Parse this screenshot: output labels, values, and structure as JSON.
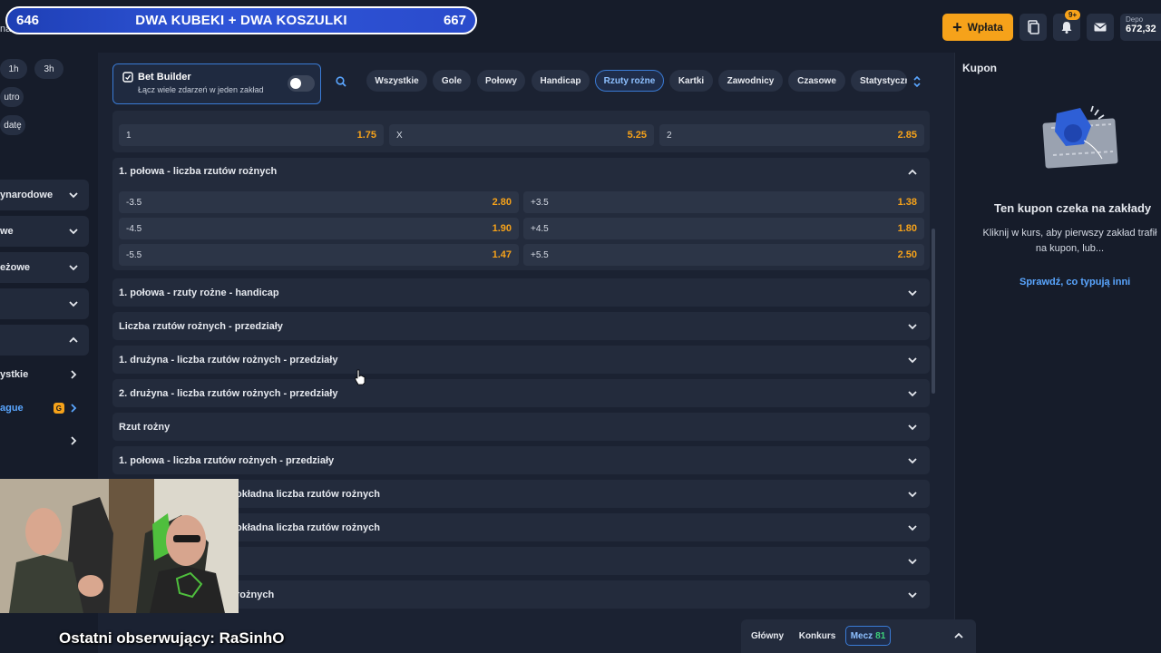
{
  "banner": {
    "left_count": "646",
    "title": "DWA KUBEKI + DWA KOSZULKI",
    "right_count": "667"
  },
  "header": {
    "left_fragment": "na",
    "deposit_label": "Wpłata",
    "notifications_badge": "9+",
    "balance_label": "Depo",
    "balance_value": "672,32"
  },
  "sidebar": {
    "time_filters": [
      "1h",
      "3h"
    ],
    "date_filters": [
      "utro",
      "datę"
    ],
    "items": [
      {
        "label": "ynarodowe"
      },
      {
        "label": "we"
      },
      {
        "label": "eżowe"
      },
      {
        "label": ""
      },
      {
        "label": ""
      }
    ],
    "sub_items": [
      {
        "label": "ystkie"
      },
      {
        "label": "ague",
        "badge": "G"
      },
      {
        "label": ""
      },
      {
        "label": ""
      }
    ],
    "bottom_fragment": "ague"
  },
  "bet_builder": {
    "title": "Bet Builder",
    "subtitle": "Łącz wiele zdarzeń w jeden zakład",
    "enabled": false
  },
  "filters": {
    "items": [
      "Wszystkie",
      "Gole",
      "Połowy",
      "Handicap",
      "Rzuty rożne",
      "Kartki",
      "Zawodnicy",
      "Czasowe",
      "Statystyczne"
    ],
    "active": "Rzuty rożne"
  },
  "top_odds": [
    {
      "label": "1",
      "value": "1.75"
    },
    {
      "label": "X",
      "value": "5.25"
    },
    {
      "label": "2",
      "value": "2.85"
    }
  ],
  "expanded_market": {
    "title": "1. połowa - liczba rzutów rożnych",
    "rows": [
      {
        "left_label": "-3.5",
        "left_value": "2.80",
        "right_label": "+3.5",
        "right_value": "1.38"
      },
      {
        "left_label": "-4.5",
        "left_value": "1.90",
        "right_label": "+4.5",
        "right_value": "1.80"
      },
      {
        "left_label": "-5.5",
        "left_value": "1.47",
        "right_label": "+5.5",
        "right_value": "2.50"
      }
    ]
  },
  "markets": [
    "1. połowa - rzuty rożne - handicap",
    "Liczba rzutów rożnych - przedziały",
    "1. drużyna - liczba rzutów rożnych - przedziały",
    "2. drużyna - liczba rzutów rożnych - przedziały",
    "Rzut rożny",
    "1. połowa - liczba rzutów rożnych - przedziały",
    "okładna liczba rzutów rożnych",
    "okładna liczba rzutów rożnych",
    "",
    "rożnych"
  ],
  "betslip": {
    "title": "Kupon",
    "empty_title": "Ten kupon czeka na zakłady",
    "empty_desc": "Kliknij w kurs, aby pierwszy zakład trafił na kupon, lub...",
    "link": "Sprawdź, co typują inni"
  },
  "bottom_tabs": {
    "tab1": "Główny",
    "tab2": "Konkurs",
    "tab3": "Mecz",
    "tab3_count": "81"
  },
  "overlay": {
    "follower_text": "Ostatni obserwujący: RaSinhO"
  },
  "colors": {
    "accent": "#f6a21a",
    "link": "#5aa6ff",
    "active_border": "#3a7bd5",
    "background": "#1b2232"
  }
}
